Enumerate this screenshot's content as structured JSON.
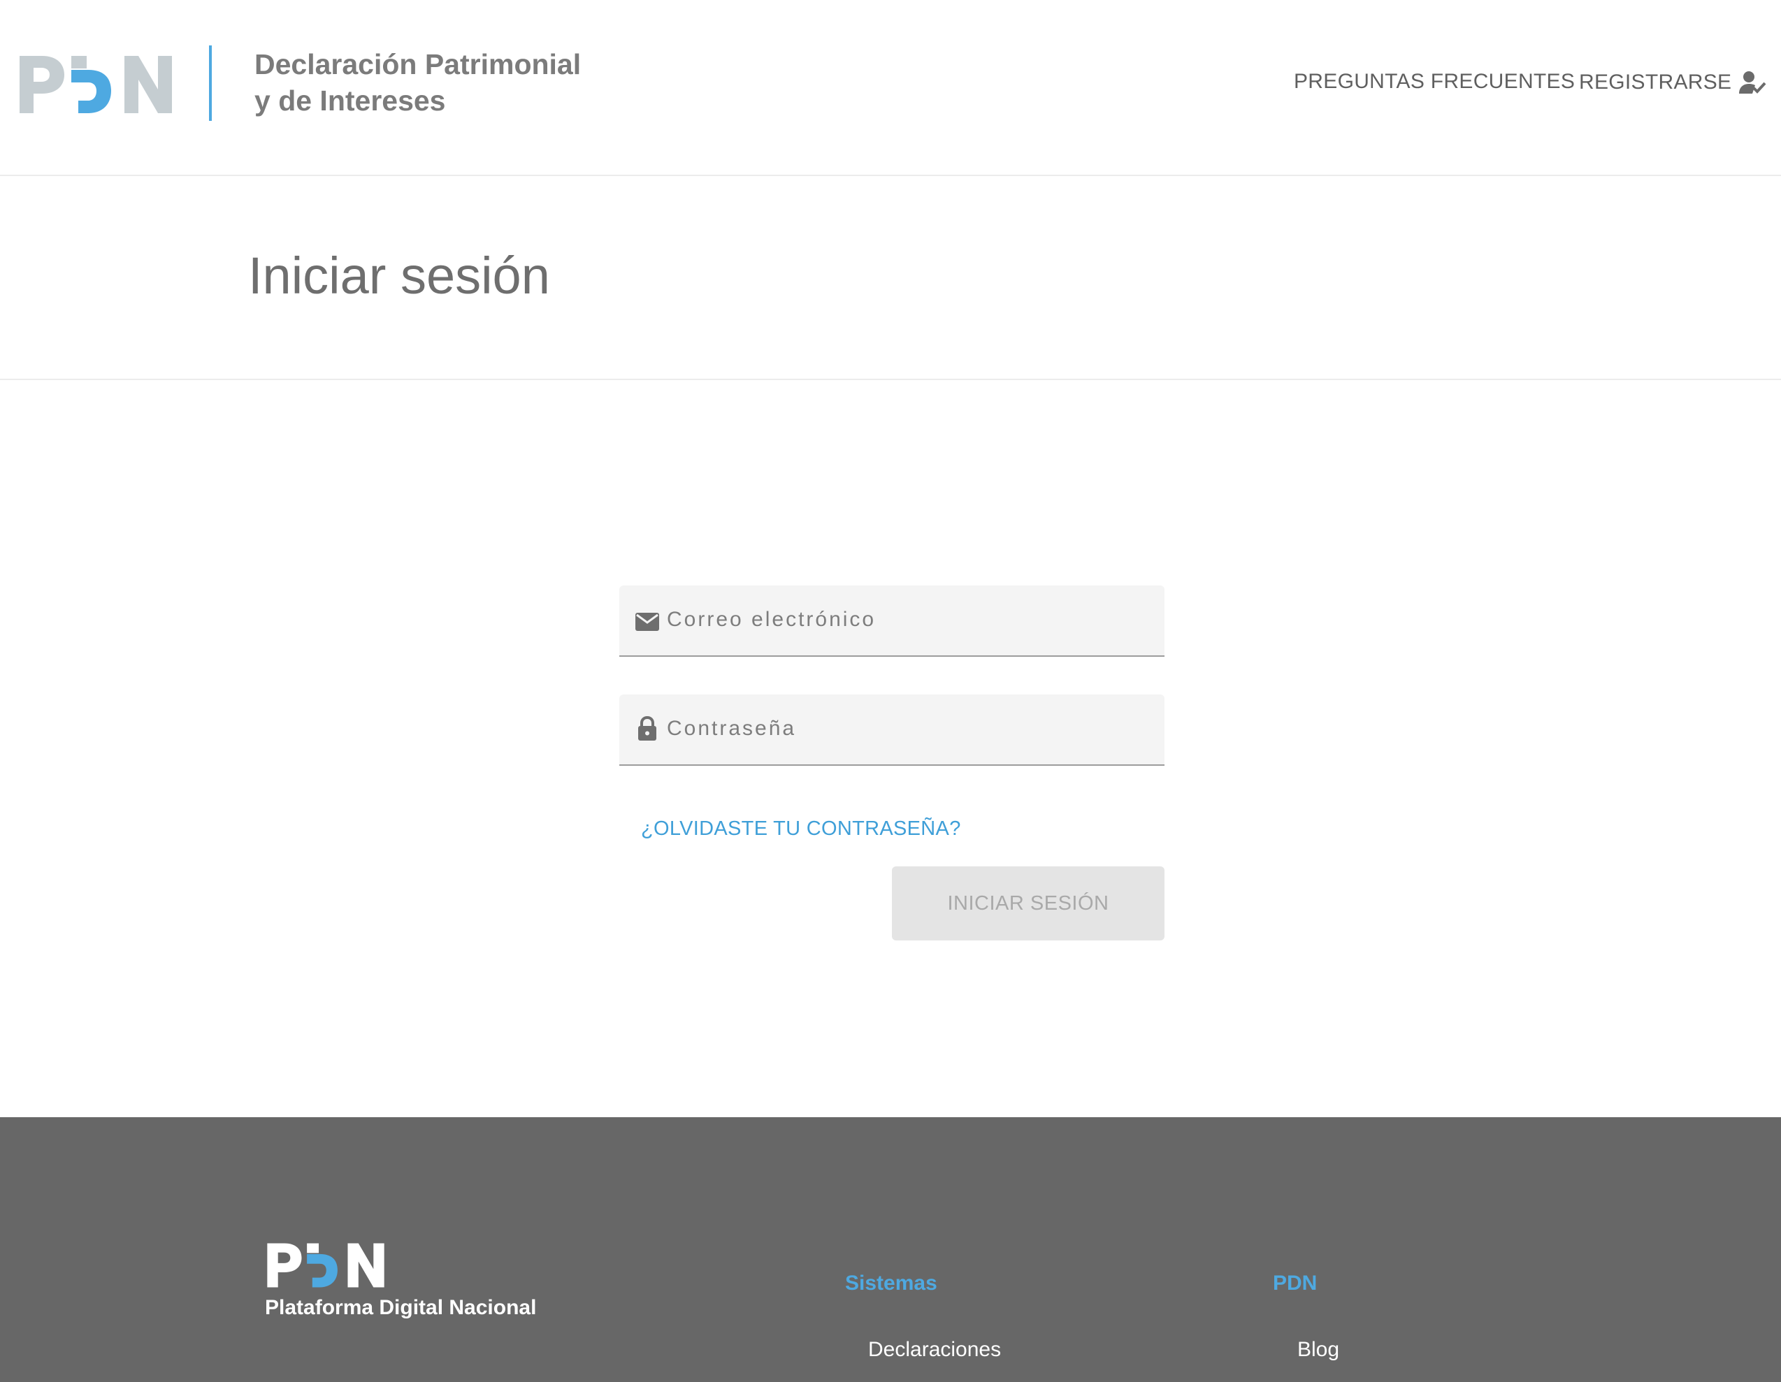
{
  "header": {
    "logo_text": "PDN",
    "app_title_line1": "Declaración Patrimonial",
    "app_title_line2": "y de Intereses",
    "nav": {
      "faq_label": "PREGUNTAS FRECUENTES",
      "register_label": "REGISTRARSE",
      "register_icon": "person-check-icon"
    }
  },
  "page": {
    "title": "Iniciar sesión"
  },
  "login_form": {
    "email": {
      "placeholder": "Correo electrónico",
      "value": "",
      "icon": "mail-icon"
    },
    "password": {
      "placeholder": "Contraseña",
      "value": "",
      "icon": "lock-icon"
    },
    "forgot_password_label": "¿OLVIDASTE TU CONTRASEÑA?",
    "submit_label": "INICIAR SESIÓN",
    "submit_enabled": false
  },
  "footer": {
    "logo_text": "PDN",
    "logo_caption": "Plataforma Digital Nacional",
    "columns": [
      {
        "heading": "Sistemas",
        "links": [
          "Declaraciones"
        ]
      },
      {
        "heading": "PDN",
        "links": [
          "Blog"
        ]
      }
    ]
  },
  "colors": {
    "accent_blue": "#4ea9e1",
    "logo_gray": "#c5cdd1",
    "footer_bg": "#676767",
    "field_bg": "#f4f4f4",
    "button_disabled_bg": "#e4e4e4"
  }
}
